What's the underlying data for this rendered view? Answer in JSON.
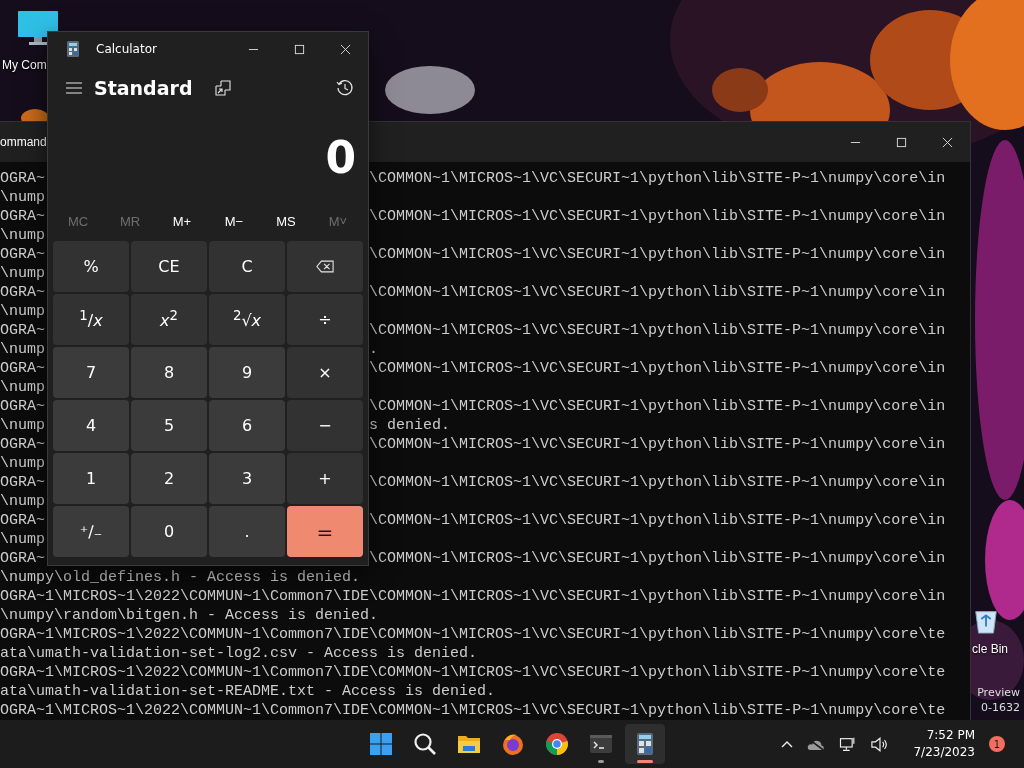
{
  "desktop": {
    "icons": [
      {
        "kind": "computer",
        "label": "My Com"
      },
      {
        "kind": "recycle",
        "label": "cle Bin"
      }
    ],
    "watermark_lines": [
      "Preview",
      "0-1632"
    ]
  },
  "terminal": {
    "title": "ommand",
    "lines": [
      {
        "text": "OGRA~",
        "tail": "\\COMMON~1\\MICROS~1\\VC\\SECURI~1\\python\\lib\\SITE-P~1\\numpy\\core\\in"
      },
      {
        "text": "\\nump"
      },
      {
        "text": "OGRA~",
        "tail": "\\COMMON~1\\MICROS~1\\VC\\SECURI~1\\python\\lib\\SITE-P~1\\numpy\\core\\in"
      },
      {
        "text": "\\nump"
      },
      {
        "text": "OGRA~",
        "tail": "\\COMMON~1\\MICROS~1\\VC\\SECURI~1\\python\\lib\\SITE-P~1\\numpy\\core\\in"
      },
      {
        "text": "\\nump"
      },
      {
        "text": "OGRA~",
        "tail": "\\COMMON~1\\MICROS~1\\VC\\SECURI~1\\python\\lib\\SITE-P~1\\numpy\\core\\in"
      },
      {
        "text": "\\nump"
      },
      {
        "text": "OGRA~",
        "tail": "\\COMMON~1\\MICROS~1\\VC\\SECURI~1\\python\\lib\\SITE-P~1\\numpy\\core\\in"
      },
      {
        "text": "\\nump",
        "tail": "."
      },
      {
        "text": "OGRA~",
        "tail": "\\COMMON~1\\MICROS~1\\VC\\SECURI~1\\python\\lib\\SITE-P~1\\numpy\\core\\in"
      },
      {
        "text": "\\nump"
      },
      {
        "text": "OGRA~",
        "tail": "\\COMMON~1\\MICROS~1\\VC\\SECURI~1\\python\\lib\\SITE-P~1\\numpy\\core\\in"
      },
      {
        "text": "\\nump",
        "tail": "s denied."
      },
      {
        "text": "OGRA~",
        "tail": "\\COMMON~1\\MICROS~1\\VC\\SECURI~1\\python\\lib\\SITE-P~1\\numpy\\core\\in"
      },
      {
        "text": "\\nump"
      },
      {
        "text": "OGRA~",
        "tail": "\\COMMON~1\\MICROS~1\\VC\\SECURI~1\\python\\lib\\SITE-P~1\\numpy\\core\\in"
      },
      {
        "text": "\\nump"
      },
      {
        "text": "OGRA~",
        "tail": "\\COMMON~1\\MICROS~1\\VC\\SECURI~1\\python\\lib\\SITE-P~1\\numpy\\core\\in"
      },
      {
        "text": "\\nump"
      },
      {
        "text": "OGRA~",
        "tail": "\\COMMON~1\\MICROS~1\\VC\\SECURI~1\\python\\lib\\SITE-P~1\\numpy\\core\\in"
      },
      {
        "text": "\\numpy\\old_defines.h - Access is denied."
      },
      {
        "text": "OGRA~1\\MICROS~1\\2022\\COMMUN~1\\Common7\\IDE\\COMMON~1\\MICROS~1\\VC\\SECURI~1\\python\\lib\\SITE-P~1\\numpy\\core\\in"
      },
      {
        "text": "\\numpy\\random\\bitgen.h - Access is denied."
      },
      {
        "text": "OGRA~1\\MICROS~1\\2022\\COMMUN~1\\Common7\\IDE\\COMMON~1\\MICROS~1\\VC\\SECURI~1\\python\\lib\\SITE-P~1\\numpy\\core\\te"
      },
      {
        "text": "ata\\umath-validation-set-log2.csv - Access is denied."
      },
      {
        "text": "OGRA~1\\MICROS~1\\2022\\COMMUN~1\\Common7\\IDE\\COMMON~1\\MICROS~1\\VC\\SECURI~1\\python\\lib\\SITE-P~1\\numpy\\core\\te"
      },
      {
        "text": "ata\\umath-validation-set-README.txt - Access is denied."
      },
      {
        "text": "OGRA~1\\MICROS~1\\2022\\COMMUN~1\\Common7\\IDE\\COMMON~1\\MICROS~1\\VC\\SECURI~1\\python\\lib\\SITE-P~1\\numpy\\core\\te"
      }
    ]
  },
  "calculator": {
    "title": "Calculator",
    "mode": "Standard",
    "display": "0",
    "memory": [
      {
        "label": "MC",
        "disabled": true
      },
      {
        "label": "MR",
        "disabled": true
      },
      {
        "label": "M+",
        "disabled": false
      },
      {
        "label": "M−",
        "disabled": false
      },
      {
        "label": "MS",
        "disabled": false
      },
      {
        "label": "M˅",
        "disabled": true
      }
    ],
    "keys": [
      {
        "kind": "func",
        "label": "%"
      },
      {
        "kind": "func",
        "label": "CE"
      },
      {
        "kind": "func",
        "label": "C"
      },
      {
        "kind": "backspace"
      },
      {
        "kind": "func",
        "label": "$^{1}$/*x*"
      },
      {
        "kind": "func",
        "label": "*x*$^{2}$"
      },
      {
        "kind": "func",
        "label": "$^{2}$√*x*"
      },
      {
        "kind": "func",
        "label": "÷"
      },
      {
        "kind": "digit",
        "label": "7"
      },
      {
        "kind": "digit",
        "label": "8"
      },
      {
        "kind": "digit",
        "label": "9"
      },
      {
        "kind": "func",
        "label": "×"
      },
      {
        "kind": "digit",
        "label": "4"
      },
      {
        "kind": "digit",
        "label": "5"
      },
      {
        "kind": "digit",
        "label": "6"
      },
      {
        "kind": "func",
        "label": "−"
      },
      {
        "kind": "digit",
        "label": "1"
      },
      {
        "kind": "digit",
        "label": "2"
      },
      {
        "kind": "digit",
        "label": "3"
      },
      {
        "kind": "func",
        "label": "+"
      },
      {
        "kind": "digit",
        "label": "⁺∕₋"
      },
      {
        "kind": "digit",
        "label": "0"
      },
      {
        "kind": "digit",
        "label": "."
      },
      {
        "kind": "equals",
        "label": "="
      }
    ]
  },
  "taskbar": {
    "apps": [
      {
        "kind": "start",
        "selected": false,
        "running": false
      },
      {
        "kind": "search",
        "selected": false,
        "running": false
      },
      {
        "kind": "folder",
        "selected": false,
        "running": false
      },
      {
        "kind": "firefox",
        "selected": false,
        "running": false
      },
      {
        "kind": "chrome",
        "selected": false,
        "running": false
      },
      {
        "kind": "terminal",
        "selected": false,
        "running": true
      },
      {
        "kind": "calculator",
        "selected": true,
        "running": true
      }
    ],
    "time": "7:52 PM",
    "date": "7/23/2023",
    "notifications": "1"
  }
}
